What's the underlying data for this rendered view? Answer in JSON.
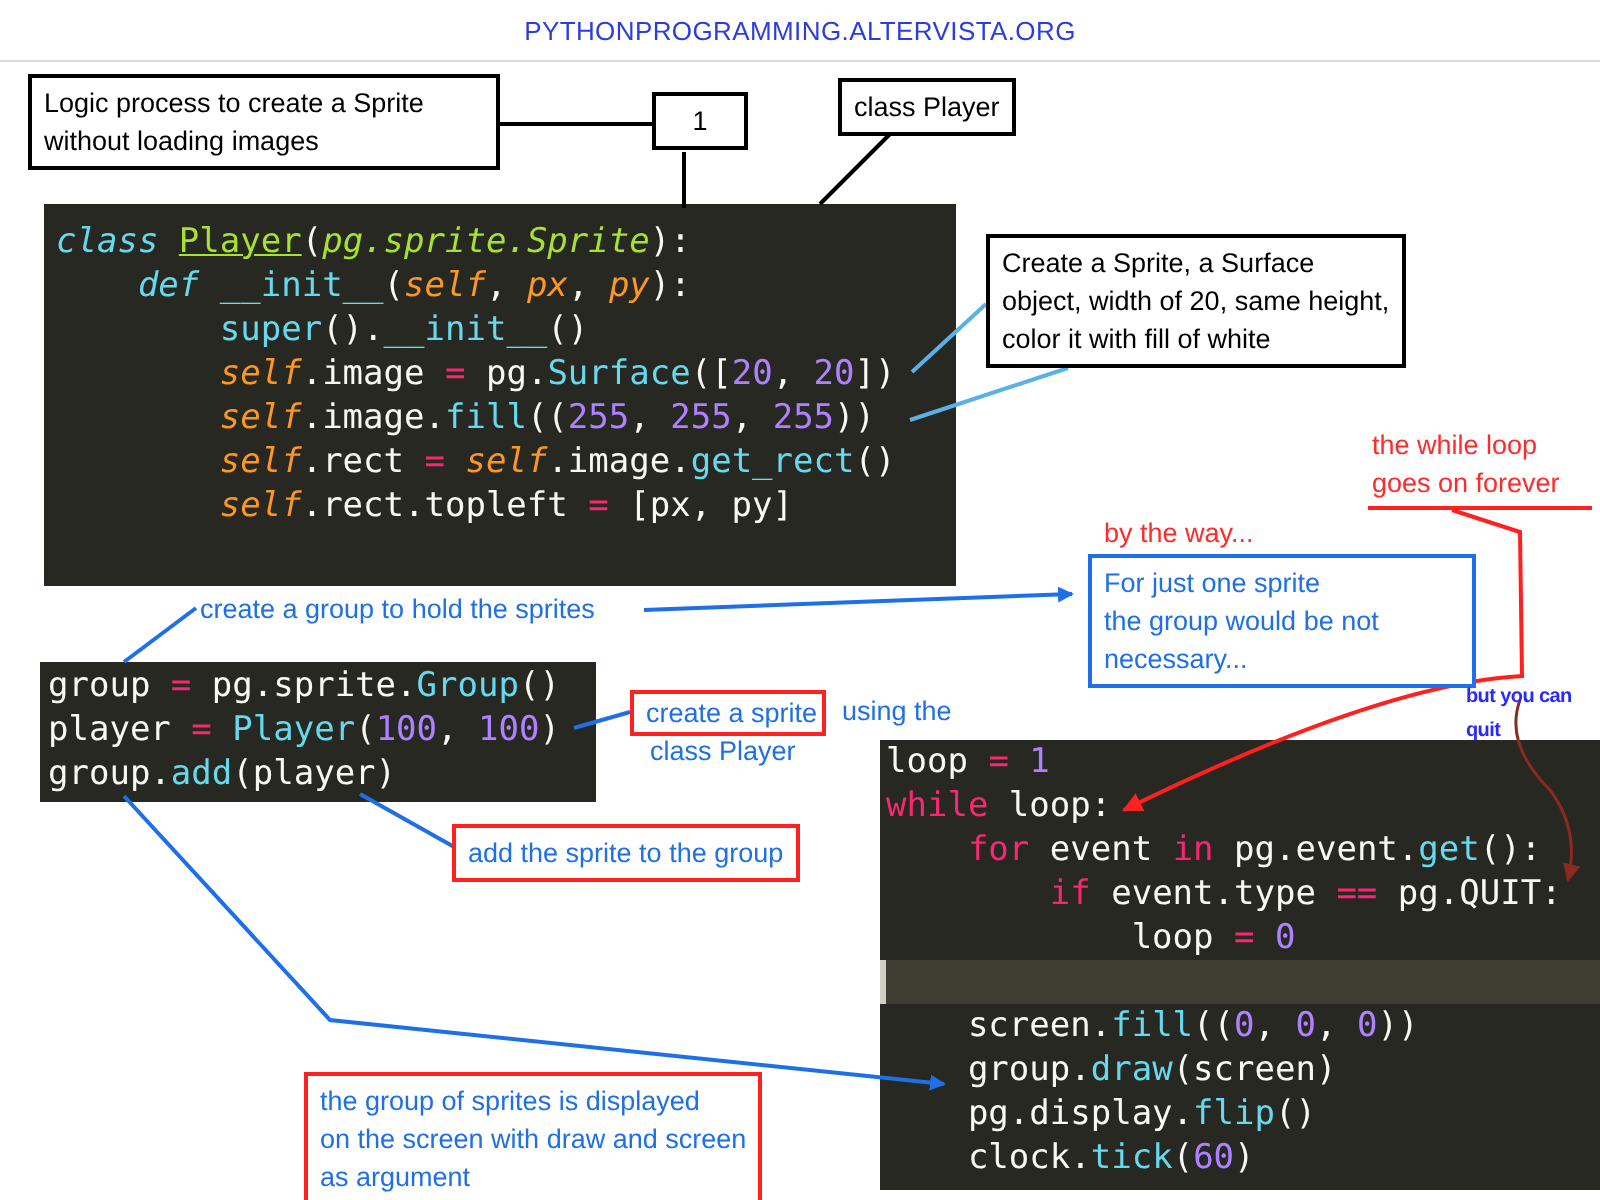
{
  "header": {
    "site": "PYTHONPROGRAMMING.ALTERVISTA.ORG"
  },
  "code_blocks": [
    {
      "lines": [
        {
          "highlighted": false,
          "tokens": [
            {
              "text": "class ",
              "kind": "kw"
            },
            {
              "text": "Player",
              "kind": "cls"
            },
            {
              "text": "(",
              "kind": "plain"
            },
            {
              "text": "pg.sprite.Sprite",
              "kind": "inherit"
            },
            {
              "text": "):",
              "kind": "plain"
            }
          ]
        },
        {
          "highlighted": false,
          "tokens": [
            {
              "text": "    def ",
              "kind": "kw"
            },
            {
              "text": "__init__",
              "kind": "fn"
            },
            {
              "text": "(",
              "kind": "plain"
            },
            {
              "text": "self",
              "kind": "arg"
            },
            {
              "text": ", ",
              "kind": "plain"
            },
            {
              "text": "px",
              "kind": "arg"
            },
            {
              "text": ", ",
              "kind": "plain"
            },
            {
              "text": "py",
              "kind": "arg"
            },
            {
              "text": "):",
              "kind": "plain"
            }
          ]
        },
        {
          "highlighted": false,
          "tokens": [
            {
              "text": "        super",
              "kind": "fn"
            },
            {
              "text": "().",
              "kind": "plain"
            },
            {
              "text": "__init__",
              "kind": "fn"
            },
            {
              "text": "()",
              "kind": "plain"
            }
          ]
        },
        {
          "highlighted": false,
          "tokens": [
            {
              "text": "        self",
              "kind": "arg"
            },
            {
              "text": ".image ",
              "kind": "plain"
            },
            {
              "text": "= ",
              "kind": "op"
            },
            {
              "text": "pg.",
              "kind": "plain"
            },
            {
              "text": "Surface",
              "kind": "fn"
            },
            {
              "text": "([",
              "kind": "plain"
            },
            {
              "text": "20",
              "kind": "num"
            },
            {
              "text": ", ",
              "kind": "plain"
            },
            {
              "text": "20",
              "kind": "num"
            },
            {
              "text": "])",
              "kind": "plain"
            }
          ]
        },
        {
          "highlighted": false,
          "tokens": [
            {
              "text": "        self",
              "kind": "arg"
            },
            {
              "text": ".image.",
              "kind": "plain"
            },
            {
              "text": "fill",
              "kind": "fn"
            },
            {
              "text": "((",
              "kind": "plain"
            },
            {
              "text": "255",
              "kind": "num"
            },
            {
              "text": ", ",
              "kind": "plain"
            },
            {
              "text": "255",
              "kind": "num"
            },
            {
              "text": ", ",
              "kind": "plain"
            },
            {
              "text": "255",
              "kind": "num"
            },
            {
              "text": "))",
              "kind": "plain"
            }
          ]
        },
        {
          "highlighted": false,
          "tokens": [
            {
              "text": "        self",
              "kind": "arg"
            },
            {
              "text": ".rect ",
              "kind": "plain"
            },
            {
              "text": "= ",
              "kind": "op"
            },
            {
              "text": "self",
              "kind": "arg"
            },
            {
              "text": ".image.",
              "kind": "plain"
            },
            {
              "text": "get_rect",
              "kind": "fn"
            },
            {
              "text": "()",
              "kind": "plain"
            }
          ]
        },
        {
          "highlighted": false,
          "tokens": [
            {
              "text": "        self",
              "kind": "arg"
            },
            {
              "text": ".rect.topleft ",
              "kind": "plain"
            },
            {
              "text": "= ",
              "kind": "op"
            },
            {
              "text": "[px, py]",
              "kind": "plain"
            }
          ]
        }
      ]
    },
    {
      "lines": [
        {
          "highlighted": false,
          "tokens": [
            {
              "text": "group ",
              "kind": "plain"
            },
            {
              "text": "= ",
              "kind": "op"
            },
            {
              "text": "pg.sprite.",
              "kind": "plain"
            },
            {
              "text": "Group",
              "kind": "fn"
            },
            {
              "text": "()",
              "kind": "plain"
            }
          ]
        },
        {
          "highlighted": false,
          "tokens": [
            {
              "text": "player ",
              "kind": "plain"
            },
            {
              "text": "= ",
              "kind": "op"
            },
            {
              "text": "Player",
              "kind": "fn"
            },
            {
              "text": "(",
              "kind": "plain"
            },
            {
              "text": "100",
              "kind": "num"
            },
            {
              "text": ", ",
              "kind": "plain"
            },
            {
              "text": "100",
              "kind": "num"
            },
            {
              "text": ")",
              "kind": "plain"
            }
          ]
        },
        {
          "highlighted": false,
          "tokens": [
            {
              "text": "group.",
              "kind": "plain"
            },
            {
              "text": "add",
              "kind": "fn"
            },
            {
              "text": "(player)",
              "kind": "plain"
            }
          ]
        }
      ]
    },
    {
      "lines": [
        {
          "highlighted": false,
          "tokens": [
            {
              "text": "loop ",
              "kind": "plain"
            },
            {
              "text": "= ",
              "kind": "op"
            },
            {
              "text": "1",
              "kind": "num"
            }
          ]
        },
        {
          "highlighted": false,
          "tokens": [
            {
              "text": "while ",
              "kind": "ctl"
            },
            {
              "text": "loop:",
              "kind": "plain"
            }
          ]
        },
        {
          "highlighted": false,
          "tokens": [
            {
              "text": "    for ",
              "kind": "ctl"
            },
            {
              "text": "event ",
              "kind": "plain"
            },
            {
              "text": "in ",
              "kind": "ctl"
            },
            {
              "text": "pg.event.",
              "kind": "plain"
            },
            {
              "text": "get",
              "kind": "fn"
            },
            {
              "text": "():",
              "kind": "plain"
            }
          ]
        },
        {
          "highlighted": false,
          "tokens": [
            {
              "text": "        if ",
              "kind": "ctl"
            },
            {
              "text": "event.type ",
              "kind": "plain"
            },
            {
              "text": "== ",
              "kind": "op"
            },
            {
              "text": "pg.QUIT:",
              "kind": "plain"
            }
          ]
        },
        {
          "highlighted": false,
          "tokens": [
            {
              "text": "            loop ",
              "kind": "plain"
            },
            {
              "text": "= ",
              "kind": "op"
            },
            {
              "text": "0",
              "kind": "num"
            }
          ]
        },
        {
          "highlighted": true
        },
        {
          "highlighted": false,
          "tokens": [
            {
              "text": "    screen.",
              "kind": "plain"
            },
            {
              "text": "fill",
              "kind": "fn"
            },
            {
              "text": "((",
              "kind": "plain"
            },
            {
              "text": "0",
              "kind": "num"
            },
            {
              "text": ", ",
              "kind": "plain"
            },
            {
              "text": "0",
              "kind": "num"
            },
            {
              "text": ", ",
              "kind": "plain"
            },
            {
              "text": "0",
              "kind": "num"
            },
            {
              "text": "))",
              "kind": "plain"
            }
          ]
        },
        {
          "highlighted": false,
          "tokens": [
            {
              "text": "    group.",
              "kind": "plain"
            },
            {
              "text": "draw",
              "kind": "fn"
            },
            {
              "text": "(screen)",
              "kind": "plain"
            }
          ]
        },
        {
          "highlighted": false,
          "tokens": [
            {
              "text": "    pg.display.",
              "kind": "plain"
            },
            {
              "text": "flip",
              "kind": "fn"
            },
            {
              "text": "()",
              "kind": "plain"
            }
          ]
        },
        {
          "highlighted": false,
          "tokens": [
            {
              "text": "    clock.",
              "kind": "plain"
            },
            {
              "text": "tick",
              "kind": "fn"
            },
            {
              "text": "(",
              "kind": "plain"
            },
            {
              "text": "60",
              "kind": "num"
            },
            {
              "text": ")",
              "kind": "plain"
            }
          ]
        }
      ]
    }
  ],
  "notes": [
    {
      "kind": "box",
      "lines": [
        "Logic process to create a Sprite",
        "without loading images"
      ]
    },
    {
      "kind": "box",
      "lines": [
        "1"
      ]
    },
    {
      "kind": "box",
      "lines": [
        "class Player"
      ]
    },
    {
      "kind": "box",
      "lines": [
        "Create a Sprite, a Surface",
        "object, width of 20, same height,",
        "color it with fill of white"
      ]
    },
    {
      "kind": "redtext",
      "lines": [
        "the while loop",
        "goes on forever"
      ]
    },
    {
      "kind": "redtext",
      "lines": [
        "by the way..."
      ]
    },
    {
      "kind": "bluetext",
      "lines": [
        "create a group to hold the sprites"
      ]
    },
    {
      "kind": "bluebox",
      "lines": [
        "For just one sprite",
        "the group would be not",
        "necessary..."
      ]
    },
    {
      "kind": "partbox",
      "boxed": "create a sprite",
      "lines": [
        "using the",
        "class Player"
      ]
    },
    {
      "kind": "redbox",
      "lines": [
        "add the sprite to the group"
      ]
    },
    {
      "kind": "redbox",
      "lines": [
        "the group of sprites is displayed",
        "on the screen with draw and screen",
        "as argument"
      ]
    },
    {
      "kind": "tiny",
      "lines": [
        "but you can",
        "quit"
      ]
    }
  ]
}
